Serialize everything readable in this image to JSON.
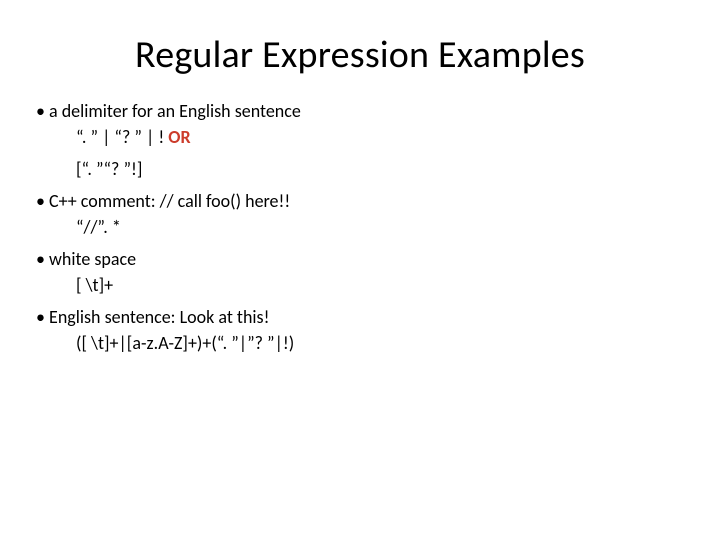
{
  "title": "Regular Expression Examples",
  "items": [
    {
      "bullet": "• a delimiter for an English sentence",
      "subs": [
        {
          "text": "“. ” | “? ” | ! ",
          "or": " OR"
        },
        {
          "text": "[“. ”“? ”!]"
        }
      ]
    },
    {
      "bullet": "• C++ comment:   // call foo() here!!",
      "subs": [
        {
          "text": "“//”. *"
        }
      ]
    },
    {
      "bullet": "• white space",
      "subs": [
        {
          "text": "[ \\t]+"
        }
      ]
    },
    {
      "bullet": "• English sentence: Look at this!",
      "subs": [
        {
          "text": "([ \\t]+|[a-z.A-Z]+)+(“. ”|”? ”|!)"
        }
      ]
    }
  ]
}
